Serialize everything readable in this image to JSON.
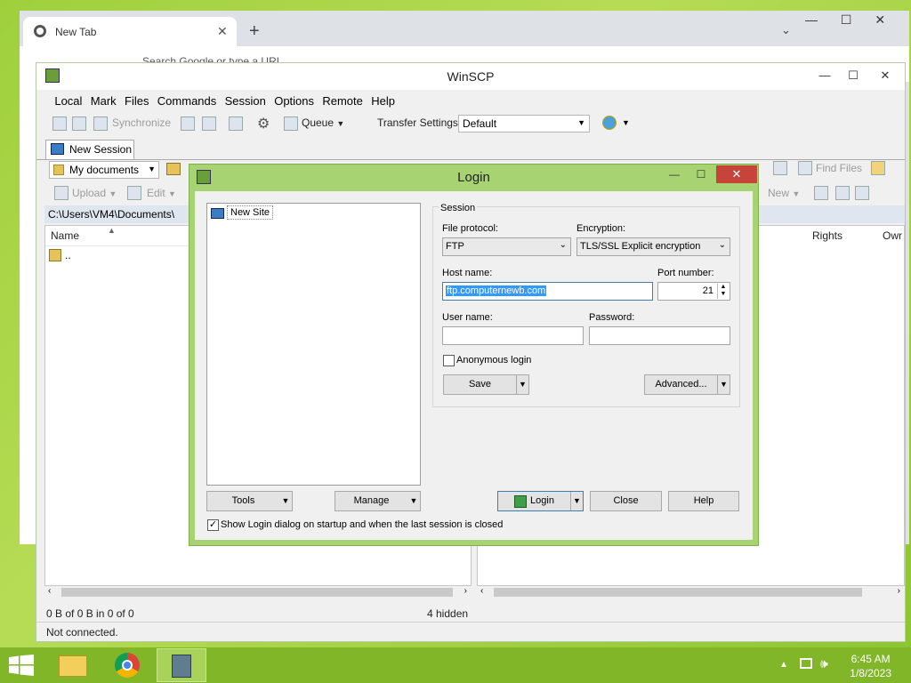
{
  "browser": {
    "tab_title": "New Tab",
    "address_placeholder": "Search Google or type a URL"
  },
  "winscp": {
    "title": "WinSCP",
    "menu": [
      "Local",
      "Mark",
      "Files",
      "Commands",
      "Session",
      "Options",
      "Remote",
      "Help"
    ],
    "toolbar": {
      "synchronize": "Synchronize",
      "queue": "Queue",
      "transfer_settings_label": "Transfer Settings",
      "transfer_settings_value": "Default"
    },
    "session_tab": "New Session",
    "local": {
      "location": "My documents",
      "upload": "Upload",
      "edit": "Edit",
      "path": "C:\\Users\\VM4\\Documents\\",
      "col_name": "Name",
      "row_parent": "..",
      "status_left": "0 B of 0 B in 0 of 0",
      "status_hidden": "4 hidden"
    },
    "remote": {
      "find_files": "Find Files",
      "new": "New",
      "col_rights": "Rights",
      "col_owner": "Owr"
    },
    "status": "Not connected."
  },
  "login": {
    "title": "Login",
    "site_new": "New Site",
    "session_group": "Session",
    "file_protocol_label": "File protocol:",
    "file_protocol_value": "FTP",
    "encryption_label": "Encryption:",
    "encryption_value": "TLS/SSL Explicit encryption",
    "host_label": "Host name:",
    "host_value": "ftp.computernewb.com",
    "port_label": "Port number:",
    "port_value": "21",
    "user_label": "User name:",
    "user_value": "",
    "password_label": "Password:",
    "password_value": "",
    "anonymous": "Anonymous login",
    "save": "Save",
    "advanced": "Advanced...",
    "tools": "Tools",
    "manage": "Manage",
    "login_btn": "Login",
    "close_btn": "Close",
    "help_btn": "Help",
    "show_on_startup": "Show Login dialog on startup and when the last session is closed"
  },
  "tray": {
    "time": "6:45 AM",
    "date": "1/8/2023"
  },
  "colors": {
    "desktop": "#9fd03c",
    "taskbar": "#82b629",
    "dialog_frame": "#a8d373",
    "close_red": "#c7443b"
  }
}
